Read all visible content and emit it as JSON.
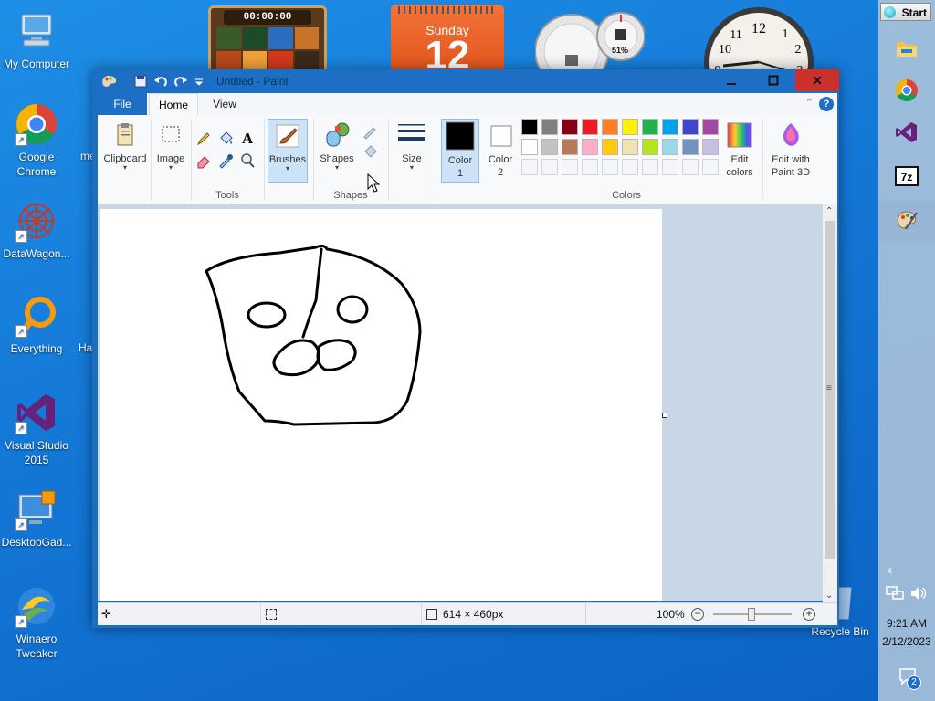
{
  "desktop": {
    "icons": [
      {
        "label": "My Computer"
      },
      {
        "label": "Google Chrome"
      },
      {
        "label": "DataWagon..."
      },
      {
        "label": "Everything"
      },
      {
        "label": "Visual Studio 2015"
      },
      {
        "label": "DesktopGad..."
      },
      {
        "label": "Winaero Tweaker"
      }
    ],
    "partial_labels": [
      "me",
      "Ha"
    ],
    "recycle_bin": "Recycle Bin"
  },
  "gadgets": {
    "puzzle_timer": "00:00:00",
    "calendar_day": "Sunday",
    "calendar_date": "12",
    "meter_percent": "51%",
    "clock_numbers": [
      "12",
      "1",
      "2",
      "3",
      "9",
      "10",
      "11"
    ]
  },
  "sidebar": {
    "start_label": "Start",
    "time": "9:21 AM",
    "date": "2/12/2023",
    "notifications": "2"
  },
  "paint": {
    "title": "Untitled - Paint",
    "tabs": {
      "file": "File",
      "home": "Home",
      "view": "View"
    },
    "ribbon": {
      "clipboard": "Clipboard",
      "image": "Image",
      "tools_group": "Tools",
      "brushes": "Brushes",
      "shapes": "Shapes",
      "shapes_group": "Shapes",
      "size": "Size",
      "color1": "Color 1",
      "color2": "Color 2",
      "colors_group": "Colors",
      "edit_colors": "Edit colors",
      "edit_paint3d": "Edit with Paint 3D"
    },
    "palette_row1": [
      "#000000",
      "#7f7f7f",
      "#880015",
      "#ed1c24",
      "#ff7f27",
      "#fff200",
      "#22b14c",
      "#00a2e8",
      "#3f48cc",
      "#a349a4"
    ],
    "palette_row2": [
      "#ffffff",
      "#c3c3c3",
      "#b97a57",
      "#ffaec9",
      "#ffc90e",
      "#efe4b0",
      "#b5e61d",
      "#99d9ea",
      "#7092be",
      "#c8bfe7"
    ],
    "status": {
      "image_size": "614 × 460px",
      "zoom": "100%"
    }
  }
}
